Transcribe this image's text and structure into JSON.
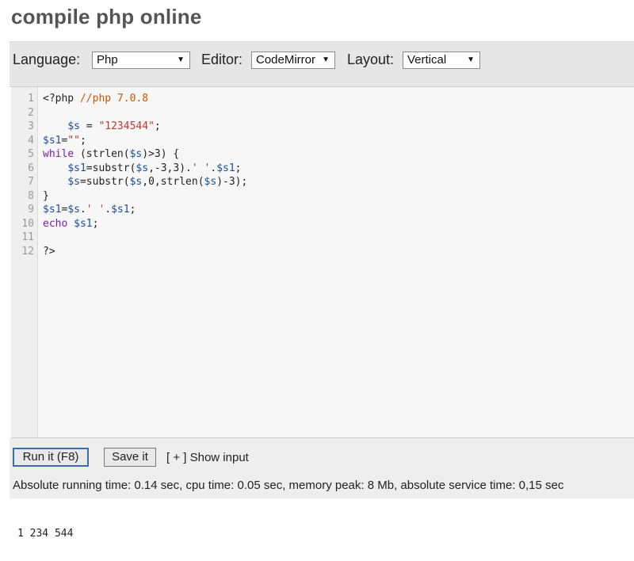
{
  "header": {
    "title": "compile php online"
  },
  "toolbar": {
    "language_label": "Language:",
    "language_value": "Php",
    "editor_label": "Editor:",
    "editor_value": "CodeMirror",
    "layout_label": "Layout:",
    "layout_value": "Vertical"
  },
  "editor": {
    "lines": [
      {
        "num": "1",
        "text": "<?php //php 7.0.8"
      },
      {
        "num": "2",
        "text": ""
      },
      {
        "num": "3",
        "text": "    $s = \"1234544\";"
      },
      {
        "num": "4",
        "text": "$s1=\"\";"
      },
      {
        "num": "5",
        "text": "while (strlen($s)>3) {"
      },
      {
        "num": "6",
        "text": "    $s1=substr($s,-3,3).' '.$s1;"
      },
      {
        "num": "7",
        "text": "    $s=substr($s,0,strlen($s)-3);"
      },
      {
        "num": "8",
        "text": "}"
      },
      {
        "num": "9",
        "text": "$s1=$s.' '.$s1;"
      },
      {
        "num": "10",
        "text": "echo $s1;"
      },
      {
        "num": "11",
        "text": ""
      },
      {
        "num": "12",
        "text": "?>"
      }
    ]
  },
  "actions": {
    "run_label": "Run it (F8)",
    "save_label": "Save it",
    "toggle_bracket": "[ + ]",
    "toggle_label": "Show input",
    "stats": "Absolute running time: 0.14 sec, cpu time: 0.05 sec, memory peak: 8 Mb, absolute service time: 0,15 sec"
  },
  "output": {
    "text": "1 234 544"
  }
}
